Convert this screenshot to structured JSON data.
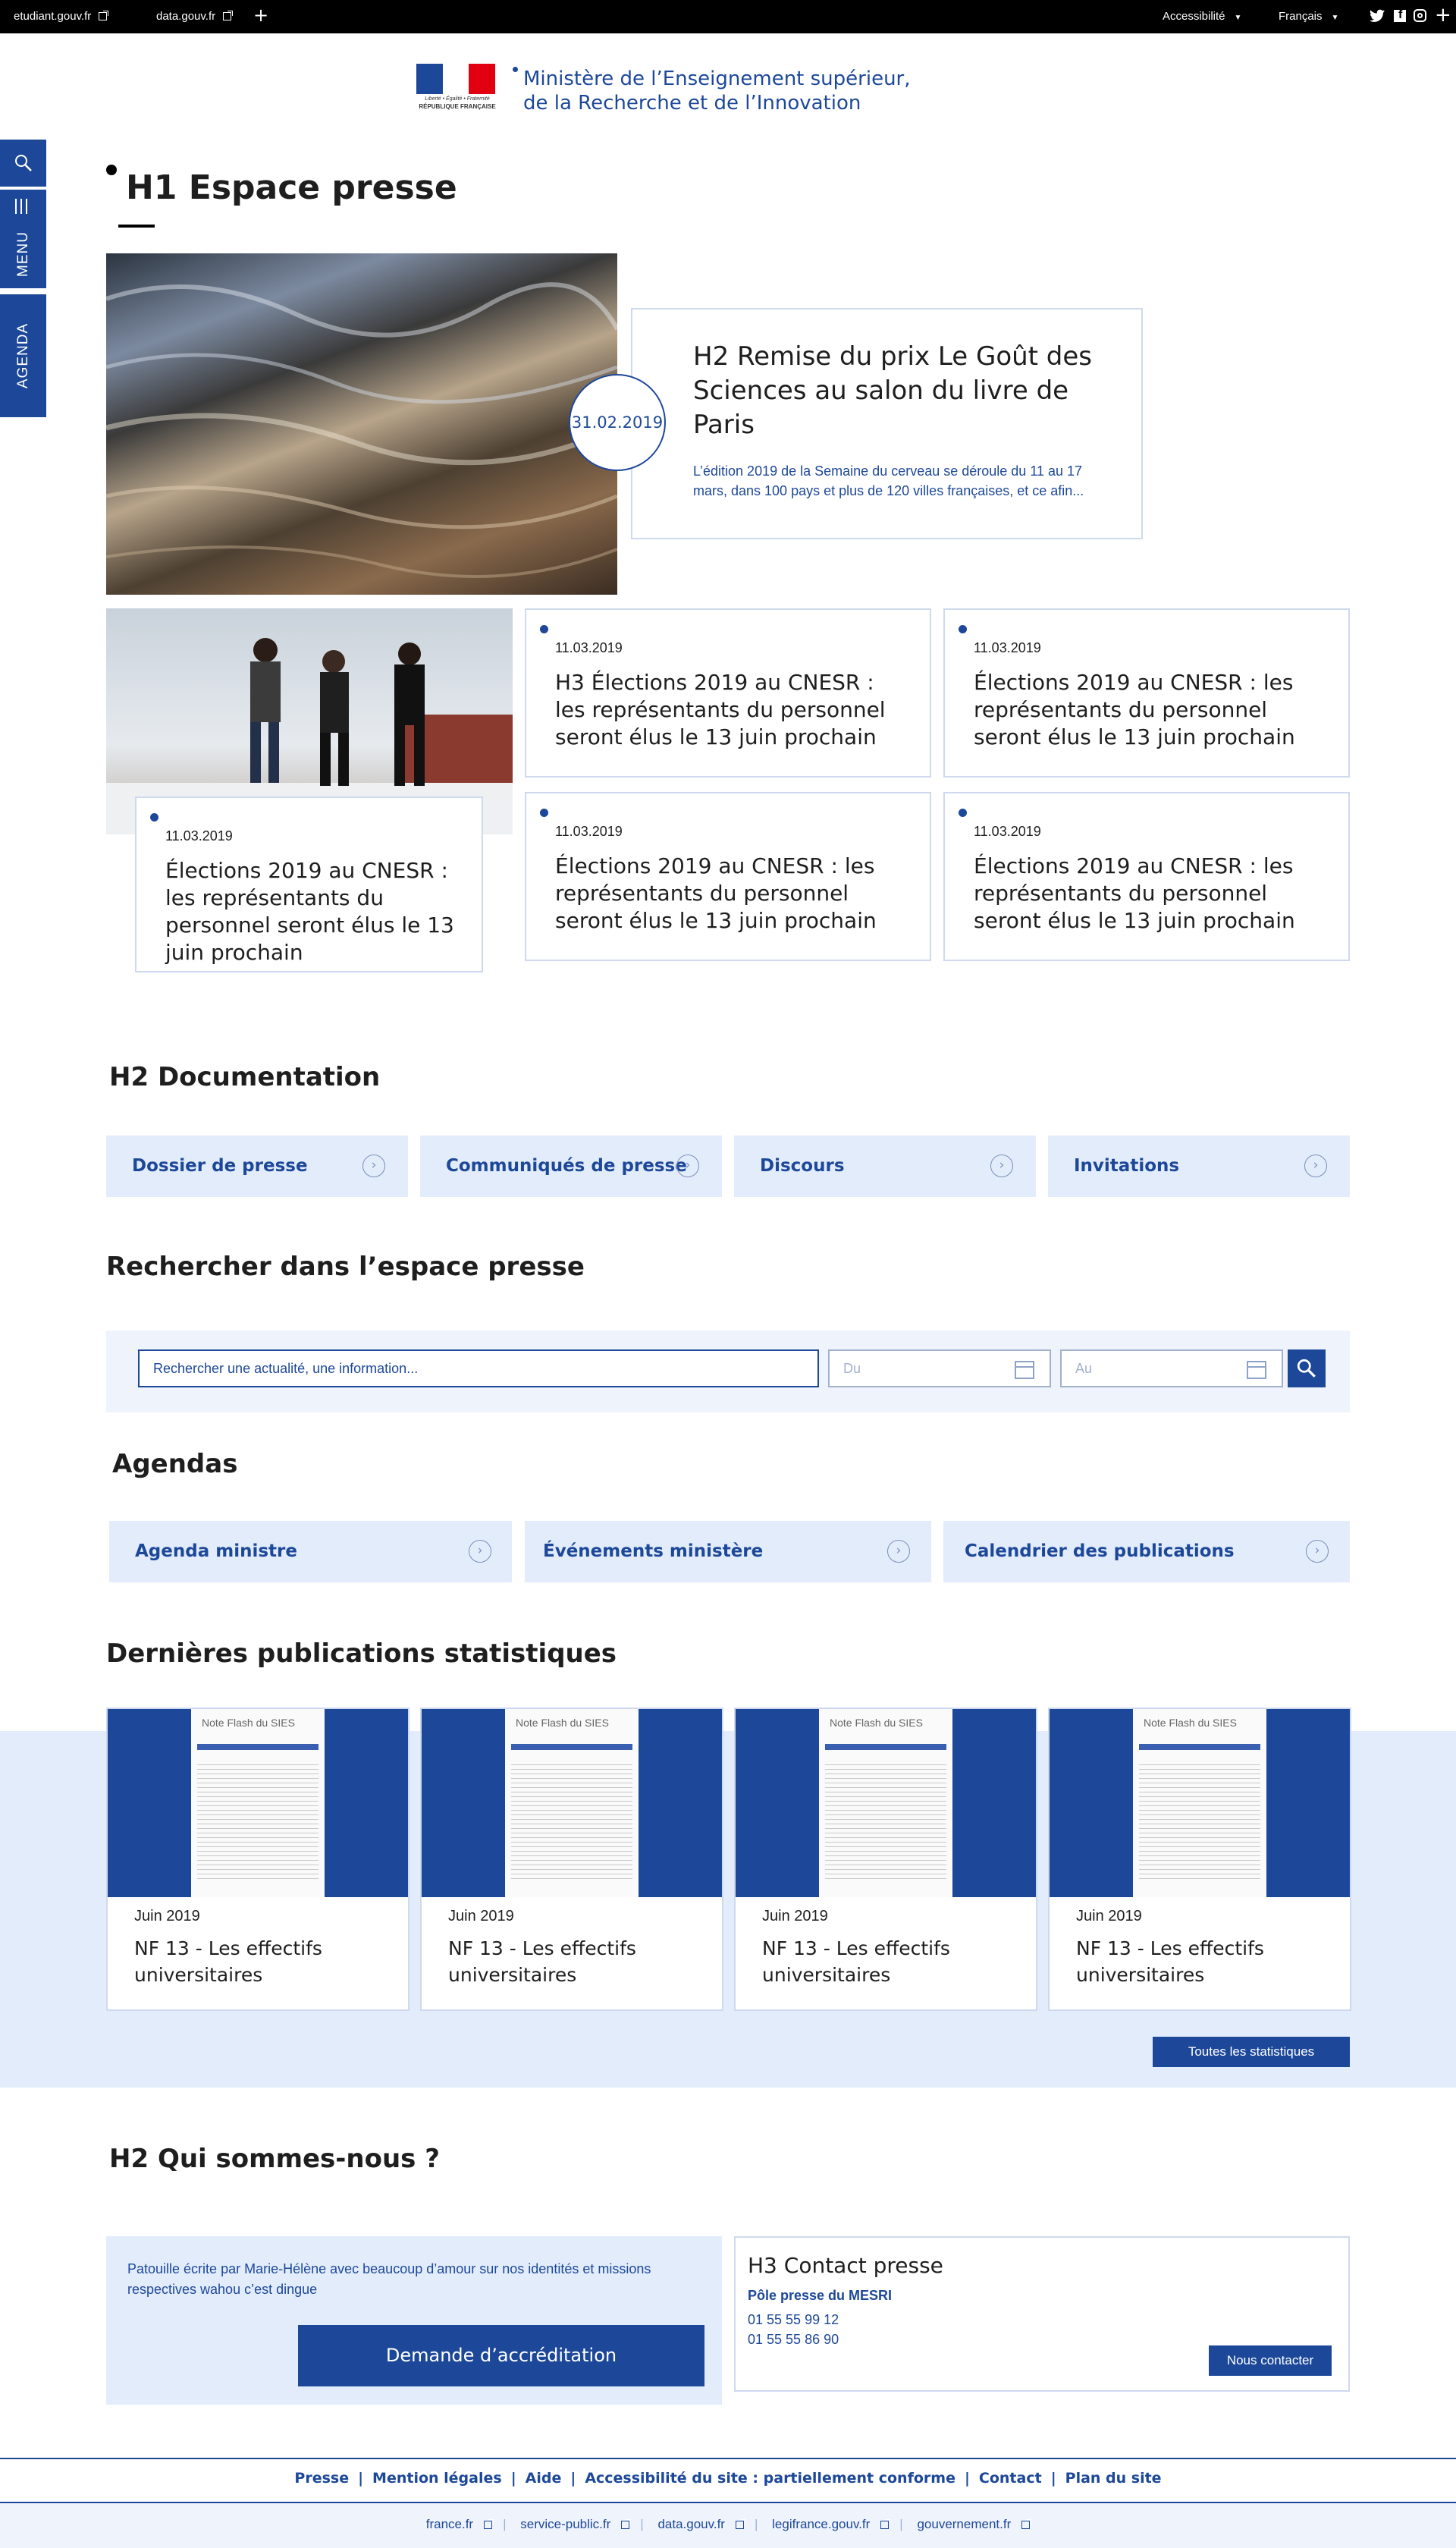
{
  "topbar": {
    "left_links": [
      "etudiant.gouv.fr",
      "data.gouv.fr"
    ],
    "accessibility": "Accessibilité",
    "language": "Français"
  },
  "header": {
    "logo_lines": [
      "Liberté • Égalité • Fraternité",
      "RÉPUBLIQUE FRANÇAISE"
    ],
    "ministry_line1": "Ministère de l’Enseignement supérieur,",
    "ministry_line2": "de la Recherche et de l’Innovation"
  },
  "sidenav": {
    "menu": "MENU",
    "agenda": "AGENDA"
  },
  "page_title": "H1 Espace presse",
  "featured": {
    "date": "31.02.2019",
    "title": "H2 Remise du prix Le Goût des Sciences au salon du livre de Paris",
    "excerpt": "L’édition 2019 de la Semaine du cerveau se déroule du 11 au 17 mars, dans 100 pays et plus de 120 villes françaises, et ce afin..."
  },
  "news": [
    {
      "date": "11.03.2019",
      "title": "Élections 2019 au CNESR : les représentants du personnel seront élus le 13 juin prochain"
    },
    {
      "date": "11.03.2019",
      "title": "H3 Élections 2019 au CNESR : les représentants du personnel seront élus le 13 juin prochain"
    },
    {
      "date": "11.03.2019",
      "title": "Élections 2019 au CNESR : les représentants du personnel seront élus le 13 juin prochain"
    },
    {
      "date": "11.03.2019",
      "title": "Élections 2019 au CNESR : les représentants du personnel seront élus le 13 juin prochain"
    },
    {
      "date": "11.03.2019",
      "title": "Élections 2019 au CNESR : les représentants du personnel seront élus le 13 juin prochain"
    }
  ],
  "documentation": {
    "title": "H2 Documentation",
    "buttons": [
      "Dossier de presse",
      "Communiqués de presse",
      "Discours",
      "Invitations"
    ]
  },
  "search": {
    "title": "Rechercher dans l’espace presse",
    "placeholder": "Rechercher une actualité, une information...",
    "from_placeholder": "Du",
    "to_placeholder": "Au"
  },
  "agendas": {
    "title": "Agendas",
    "buttons": [
      "Agenda ministre",
      "Événements ministère",
      "Calendrier des publications"
    ]
  },
  "stats": {
    "title": "Dernières publications statistiques",
    "publications": [
      {
        "date": "Juin 2019",
        "title": "NF 13 - Les effectifs universitaires"
      },
      {
        "date": "Juin 2019",
        "title": "NF 13 - Les effectifs universitaires"
      },
      {
        "date": "Juin 2019",
        "title": "NF 13 - Les effectifs universitaires"
      },
      {
        "date": "Juin 2019",
        "title": "NF 13 - Les effectifs universitaires"
      }
    ],
    "thumb_label": "Note Flash du SIES",
    "all_button": "Toutes les statistiques"
  },
  "about": {
    "title": "H2 Qui sommes-nous ?",
    "text": "Patouille écrite par Marie-Hélène avec beaucoup d’amour sur nos identités et missions respectives wahou c’est dingue",
    "accreditation_button": "Demande d’accréditation"
  },
  "contact": {
    "title": "H3 Contact presse",
    "pole": "Pôle presse du MESRI",
    "phone1": "01 55 55 99 12",
    "phone2": "01 55 55 86 90",
    "button": "Nous contacter"
  },
  "footer": {
    "links": [
      "Presse",
      "Mention légales",
      "Aide",
      "Accessibilité du site : partiellement conforme",
      "Contact",
      "Plan du site"
    ],
    "gov_links": [
      "france.fr",
      "service-public.fr",
      "data.gouv.fr",
      "legifrance.gouv.fr",
      "gouvernement.fr"
    ]
  },
  "colors": {
    "primary": "#1d4899",
    "light_bg": "#e2ecfb",
    "border": "#cfd9ee",
    "topbar": "#000000"
  }
}
